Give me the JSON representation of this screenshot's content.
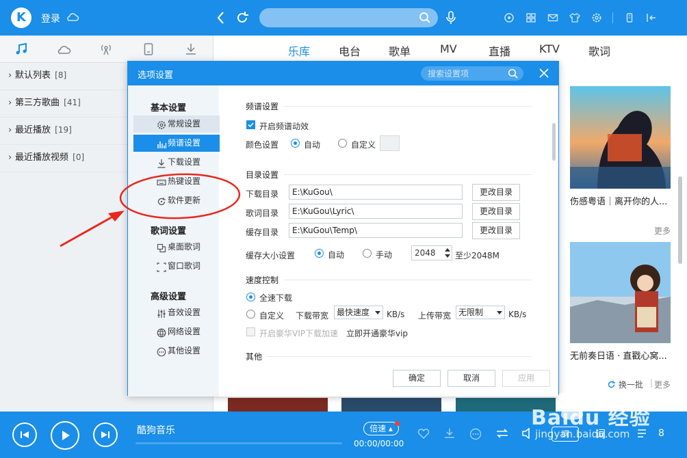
{
  "app": {
    "login": "登录",
    "logo_letter": "K",
    "icons": [
      "cloud-icon",
      "back-icon",
      "refresh-icon",
      "search-icon",
      "mic-icon",
      "game-icon",
      "apps-icon",
      "mail-icon",
      "skin-icon",
      "settings-icon",
      "mini-mode-icon",
      "exit-mini-icon"
    ]
  },
  "left": {
    "tabs": [
      "music-icon",
      "cloud-icon",
      "radio-icon",
      "device-icon",
      "download-icon"
    ],
    "items": [
      {
        "label": "默认列表",
        "count": "[8]"
      },
      {
        "label": "第三方歌曲",
        "count": "[41]"
      },
      {
        "label": "最近播放",
        "count": "[19]"
      },
      {
        "label": "最近播放视频",
        "count": "[0]"
      }
    ]
  },
  "nav": {
    "tabs": [
      "乐库",
      "电台",
      "歌单",
      "MV",
      "直播",
      "KTV",
      "歌词"
    ],
    "active": "乐库"
  },
  "content": {
    "cards": [
      {
        "title": "伤感粤语｜离开你的人..."
      },
      {
        "title": "无前奏日语 · 直戳心窝..."
      }
    ],
    "more": "更多",
    "more2": "更多",
    "refresh_batch": "换一批"
  },
  "dialog": {
    "title": "选项设置",
    "search_placeholder": "搜索设置项",
    "side": {
      "group1": "基本设置",
      "items1": [
        "常规设置",
        "频谱设置",
        "下载设置",
        "热键设置",
        "软件更新"
      ],
      "group2": "歌词设置",
      "items2": [
        "桌面歌词",
        "窗口歌词"
      ],
      "group3": "高级设置",
      "items3": [
        "音效设置",
        "网络设置",
        "其他设置"
      ],
      "active": "频谱设置"
    },
    "spectrum": {
      "title": "频谱设置",
      "enable_label": "开启频谱动效",
      "enable_checked": true,
      "color_label": "颜色设置",
      "auto": "自动",
      "custom": "自定义",
      "selected": "自动"
    },
    "dirs": {
      "title": "目录设置",
      "download_label": "下载目录",
      "download_path": "E:\\KuGou\\",
      "lyric_label": "歌词目录",
      "lyric_path": "E:\\KuGou\\Lyric\\",
      "cache_label": "缓存目录",
      "cache_path": "E:\\KuGou\\Temp\\",
      "change_btn": "更改目录",
      "cache_size_label": "缓存大小设置",
      "auto": "自动",
      "manual": "手动",
      "cache_size": "2048",
      "min_note": "至少2048M",
      "selected": "自动"
    },
    "speed": {
      "title": "速度控制",
      "full": "全速下载",
      "custom": "自定义",
      "down_label": "下载带宽",
      "down_value": "最快速度",
      "unit1": "KB/s",
      "up_label": "上传带宽",
      "up_value": "无限制",
      "unit2": "KB/s",
      "vip_label": "开启豪华VIP下载加速",
      "vip_link": "立即开通豪华vip",
      "selected": "全速下载"
    },
    "other_title": "其他",
    "buttons": {
      "ok": "确定",
      "cancel": "取消",
      "apply": "应用"
    }
  },
  "player": {
    "song": "酷狗音乐",
    "speed": "倍速",
    "time": "00:00/00:00",
    "lyric": "词",
    "queue_count": "8"
  },
  "watermark": {
    "text": "Baidu 经验",
    "sub": "jingyan.baidu.com"
  },
  "colors": {
    "accent": "#1a8ee8",
    "annotation": "#e8281e"
  }
}
